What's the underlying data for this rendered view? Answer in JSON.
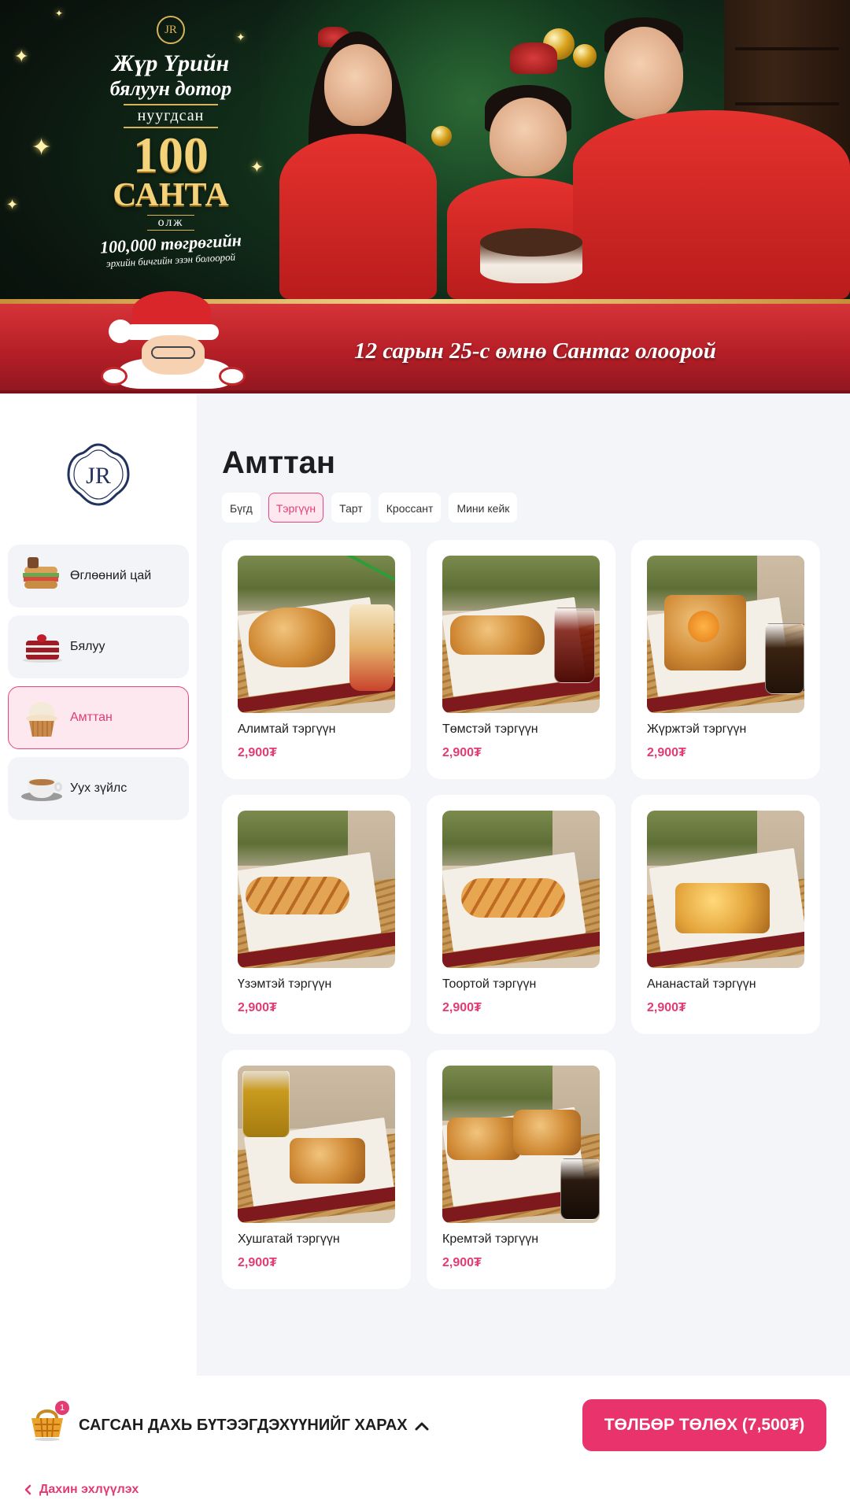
{
  "banner": {
    "promo_line1": "Жүр Үрийн",
    "promo_line2": "бялуун дотор",
    "promo_line3": "нуугдсан",
    "promo_big_number": "100",
    "promo_big_word": "САНТА",
    "promo_line4": "олж",
    "promo_line5": "100,000 төгрөгийн",
    "promo_line6": "эрхийн бичгийн эзэн болоорой",
    "ribbon_text": "12 сарын 25-с өмнө Сантаг олоорой",
    "logo_monogram": "JR"
  },
  "sidebar": {
    "logo_monogram": "JR",
    "items": [
      {
        "label": "Өглөөний цай",
        "icon": "sandwich-icon",
        "active": false
      },
      {
        "label": "Бялуу",
        "icon": "cake-slice-icon",
        "active": false
      },
      {
        "label": "Амттан",
        "icon": "cupcake-icon",
        "active": true
      },
      {
        "label": "Уух зүйлс",
        "icon": "coffee-cup-icon",
        "active": false
      }
    ]
  },
  "main": {
    "title": "Амттан",
    "filters": [
      {
        "label": "Бүгд",
        "active": false
      },
      {
        "label": "Тэргүүн",
        "active": true
      },
      {
        "label": "Тарт",
        "active": false
      },
      {
        "label": "Кроссант",
        "active": false
      },
      {
        "label": "Мини кейк",
        "active": false
      }
    ],
    "products": [
      {
        "name": "Алимтай тэргүүн",
        "price": "2,900₮"
      },
      {
        "name": "Төмстэй тэргүүн",
        "price": "2,900₮"
      },
      {
        "name": "Жүржтэй тэргүүн",
        "price": "2,900₮"
      },
      {
        "name": "Үзэмтэй тэргүүн",
        "price": "2,900₮"
      },
      {
        "name": "Тоортой тэргүүн",
        "price": "2,900₮"
      },
      {
        "name": "Ананастай тэргүүн",
        "price": "2,900₮"
      },
      {
        "name": "Хушгатай тэргүүн",
        "price": "2,900₮"
      },
      {
        "name": "Кремтэй тэргүүн",
        "price": "2,900₮"
      }
    ]
  },
  "footer": {
    "cart_count": "1",
    "cart_label": "САГСАН ДАХЬ БҮТЭЭГДЭХҮҮНИЙГ ХАРАХ",
    "pay_label": "ТӨЛБӨР ТӨЛӨХ (7,500₮)",
    "restart_label": "Дахин эхлүүлэх"
  },
  "colors": {
    "accent": "#e8336d",
    "accent_text": "#e23c72",
    "active_bg": "#fde8ef",
    "banner_red": "#b71f27",
    "gold": "#d8b35a"
  }
}
